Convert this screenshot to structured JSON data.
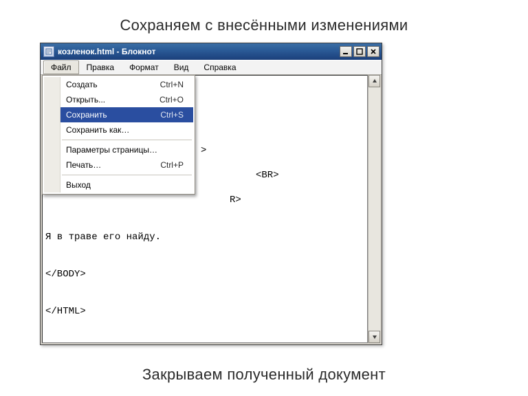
{
  "slide": {
    "caption_top": "Сохраняем с внесёнными изменениями",
    "caption_bottom": "Закрываем полученный документ"
  },
  "window": {
    "title": "козленок.html - Блокнот",
    "icon_name": "notepad-icon"
  },
  "menubar": {
    "items": [
      {
        "label": "Файл",
        "active": true
      },
      {
        "label": "Правка",
        "active": false
      },
      {
        "label": "Формат",
        "active": false
      },
      {
        "label": "Вид",
        "active": false
      },
      {
        "label": "Справка",
        "active": false
      }
    ]
  },
  "dropdown": {
    "items": [
      {
        "label": "Создать",
        "shortcut": "Ctrl+N",
        "highlight": false
      },
      {
        "label": "Открыть...",
        "shortcut": "Ctrl+O",
        "highlight": false
      },
      {
        "label": "Сохранить",
        "shortcut": "Ctrl+S",
        "highlight": true
      },
      {
        "label": "Сохранить как…",
        "shortcut": "",
        "highlight": false
      },
      {
        "separator": true
      },
      {
        "label": "Параметры страницы…",
        "shortcut": "",
        "highlight": false
      },
      {
        "label": "Печать…",
        "shortcut": "Ctrl+P",
        "highlight": false
      },
      {
        "separator": true
      },
      {
        "label": "Выход",
        "shortcut": "",
        "highlight": false
      }
    ]
  },
  "document": {
    "visible_fragments": [
      ">",
      "<BR>",
      "R>"
    ],
    "body_tail": [
      "Я в траве его найду.",
      "</BODY>",
      "</HTML>"
    ]
  },
  "win_controls": {
    "minimize": "_",
    "maximize": "□",
    "close": "×"
  }
}
